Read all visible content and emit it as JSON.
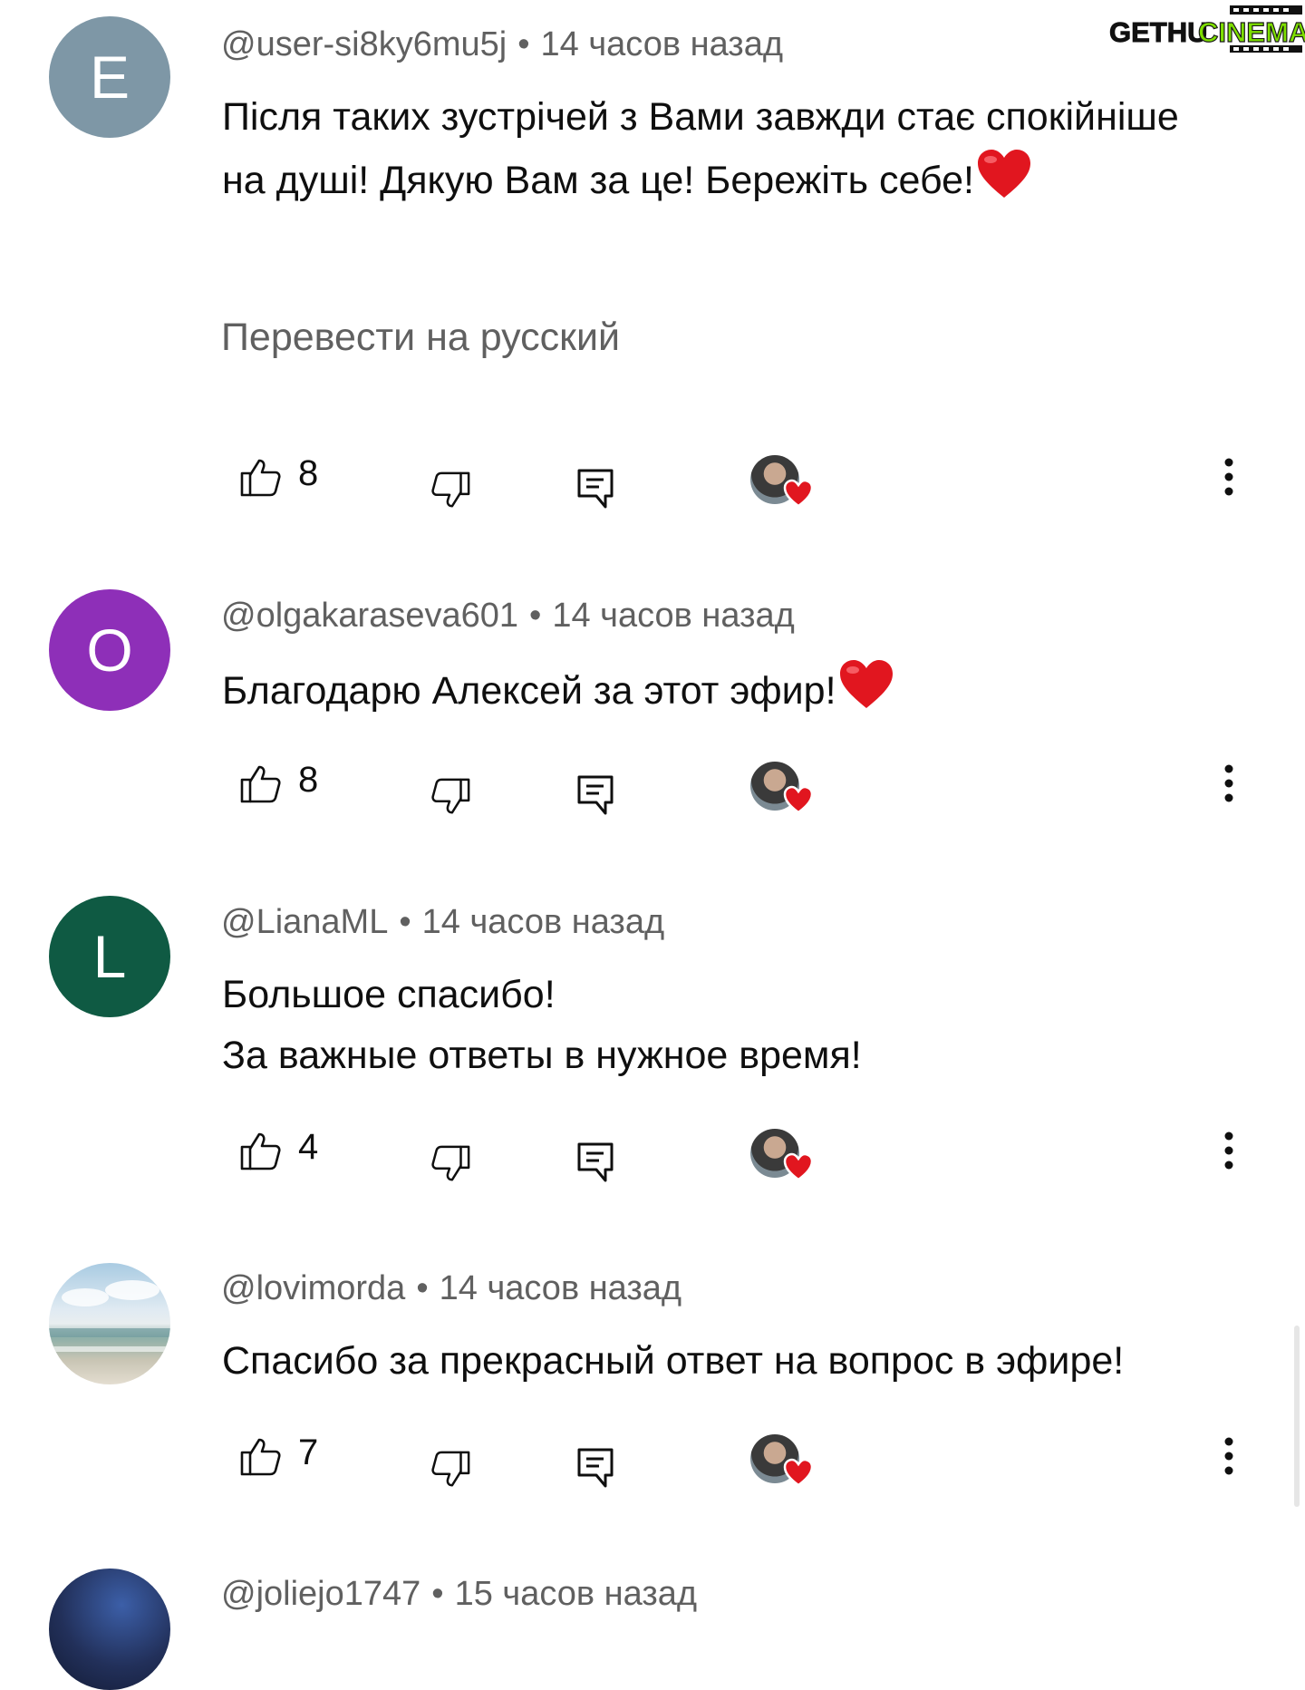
{
  "watermark": {
    "brand_left": "GETHU",
    "brand_right": "CINEMA"
  },
  "comments": [
    {
      "avatar_letter": "E",
      "avatar_color": "#7e97a6",
      "username": "@user-si8ky6mu5j",
      "separator": "•",
      "time": "14 часов назад",
      "text": "Після таких зустрічей з Вами  завжди стає спокійніше на душі! Дякую Вам за це! Бережіть себе!",
      "emoji": "heart",
      "translate": "Перевести на русский",
      "likes": "8"
    },
    {
      "avatar_letter": "O",
      "avatar_color": "#8e2fb8",
      "username": "@olgakaraseva601",
      "separator": "•",
      "time": "14 часов назад",
      "text": "Благодарю Алексей за этот эфир!",
      "emoji": "heart",
      "likes": "8"
    },
    {
      "avatar_letter": "L",
      "avatar_color": "#0f5a43",
      "username": "@LianaML",
      "separator": "•",
      "time": "14 часов назад",
      "text": "Большое спасибо!\nЗа важные ответы в нужное время!",
      "likes": "4"
    },
    {
      "avatar_letter": "",
      "avatar_color": "#9fc2d8",
      "username": "@lovimorda",
      "separator": "•",
      "time": "14 часов назад",
      "text": "Спасибо за прекрасный ответ на вопрос в эфире!",
      "likes": "7"
    },
    {
      "avatar_letter": "",
      "avatar_color": "#22305a",
      "username": "@joliejo1747",
      "separator": "•",
      "time": "15 часов назад"
    }
  ],
  "icons": {
    "like": "thumb-up-icon",
    "dislike": "thumb-down-icon",
    "reply": "reply-comment-icon",
    "creator_heart": "creator-heart-icon",
    "more": "more-vertical-icon"
  },
  "colors": {
    "meta_text": "#606060",
    "body_text": "#0f0f0f",
    "heart": "#e1161f",
    "watermark_green": "#7ee000"
  }
}
